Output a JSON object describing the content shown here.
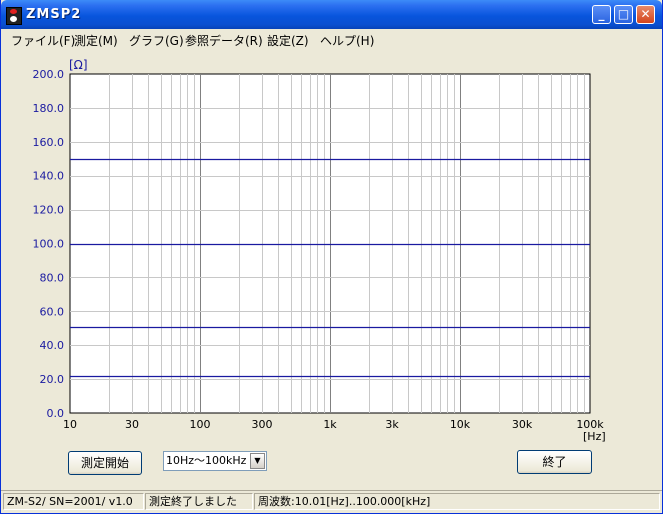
{
  "window": {
    "title": "ZMSP2",
    "minimize_glyph": "_",
    "maximize_glyph": "□",
    "close_glyph": "✕"
  },
  "menu": [
    {
      "label": "ファイル(F)"
    },
    {
      "label": "測定(M)"
    },
    {
      "label": "グラフ(G)"
    },
    {
      "label": "参照データ(R)"
    },
    {
      "label": "設定(Z)"
    },
    {
      "label": "ヘルプ(H)"
    }
  ],
  "chart_data": {
    "type": "line",
    "title": "",
    "ylabel": "[Ω]",
    "xlabel": "[Hz]",
    "x_scale": "log",
    "xlim": [
      10,
      100000
    ],
    "ylim": [
      0,
      200
    ],
    "grid": true,
    "y_ticks": [
      "0.0",
      "20.0",
      "40.0",
      "60.0",
      "80.0",
      "100.0",
      "120.0",
      "140.0",
      "160.0",
      "180.0",
      "200.0"
    ],
    "x_ticks": [
      {
        "value": 10,
        "label": "10"
      },
      {
        "value": 30,
        "label": "30"
      },
      {
        "value": 100,
        "label": "100"
      },
      {
        "value": 300,
        "label": "300"
      },
      {
        "value": 1000,
        "label": "1k"
      },
      {
        "value": 3000,
        "label": "3k"
      },
      {
        "value": 10000,
        "label": "10k"
      },
      {
        "value": 30000,
        "label": "30k"
      },
      {
        "value": 100000,
        "label": "100k"
      }
    ],
    "series_color": "#1a1aa0",
    "series": [
      {
        "x": [
          10,
          100000
        ],
        "y": [
          150,
          150
        ]
      },
      {
        "x": [
          10,
          100000
        ],
        "y": [
          100,
          100
        ]
      },
      {
        "x": [
          10,
          100000
        ],
        "y": [
          51,
          51
        ]
      },
      {
        "x": [
          10,
          100000
        ],
        "y": [
          22,
          22
        ]
      }
    ]
  },
  "controls": {
    "start_button": "測定開始",
    "range_select": "10Hz～100kHz",
    "end_button": "終了"
  },
  "status": {
    "device": "ZM-S2/ SN=2001/ v1.0",
    "message": "測定終了しました",
    "freq_range": "周波数:10.01[Hz]..100.000[kHz]"
  }
}
